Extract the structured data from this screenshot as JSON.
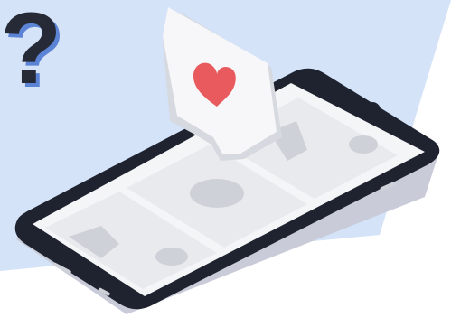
{
  "scene": {
    "kind": "isometric-phone-illustration",
    "colors": {
      "background": "#ffffff",
      "backdrop_panel": "#d4e3f7",
      "phone_body": "#1f2330",
      "phone_edge": "#c9ccd8",
      "screen": "#f4f5f7",
      "card": "#e9eaee",
      "card_shape": "#cfd1d8",
      "bubble": "#f7f7f9",
      "bubble_shadow": "#d7d9e0",
      "heart": "#e85a5e",
      "question_mark_fill": "#262a37",
      "question_mark_outline": "#5c84d6"
    },
    "question_mark_icon": {
      "name": "question-mark-icon",
      "text": "?"
    },
    "like_bubble": {
      "icon": "heart-icon"
    },
    "phone": {
      "cards": [
        {
          "name": "image-placeholder-card",
          "shapes": [
            "mountain",
            "circle"
          ]
        },
        {
          "name": "circle-placeholder-card",
          "shapes": [
            "circle"
          ]
        },
        {
          "name": "image-placeholder-card",
          "shapes": [
            "mountain",
            "circle"
          ]
        }
      ]
    }
  }
}
